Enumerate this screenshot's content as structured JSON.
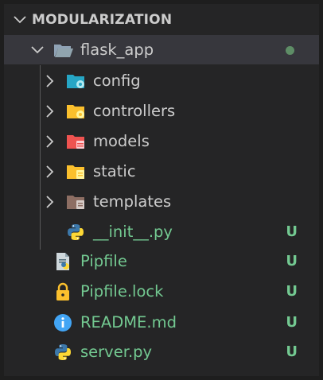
{
  "explorer": {
    "section_title": "MODULARIZATION",
    "root_folder": {
      "name": "flask_app",
      "status": "modified"
    },
    "folders": [
      {
        "name": "config",
        "icon": "folder-config-icon"
      },
      {
        "name": "controllers",
        "icon": "folder-controllers-icon"
      },
      {
        "name": "models",
        "icon": "folder-models-icon"
      },
      {
        "name": "static",
        "icon": "folder-static-icon"
      },
      {
        "name": "templates",
        "icon": "folder-templates-icon"
      }
    ],
    "files": [
      {
        "name": "__init__.py",
        "icon": "python-icon",
        "status": "U"
      },
      {
        "name": "Pipfile",
        "icon": "file-document-icon",
        "status": "U"
      },
      {
        "name": "Pipfile.lock",
        "icon": "lock-icon",
        "status": "U"
      },
      {
        "name": "README.md",
        "icon": "info-icon",
        "status": "U"
      },
      {
        "name": "server.py",
        "icon": "python-icon",
        "status": "U"
      }
    ]
  },
  "colors": {
    "background": "#252526",
    "selected_row": "#37373d",
    "untracked": "#73c991",
    "modified_dot": "#5e8d66"
  }
}
